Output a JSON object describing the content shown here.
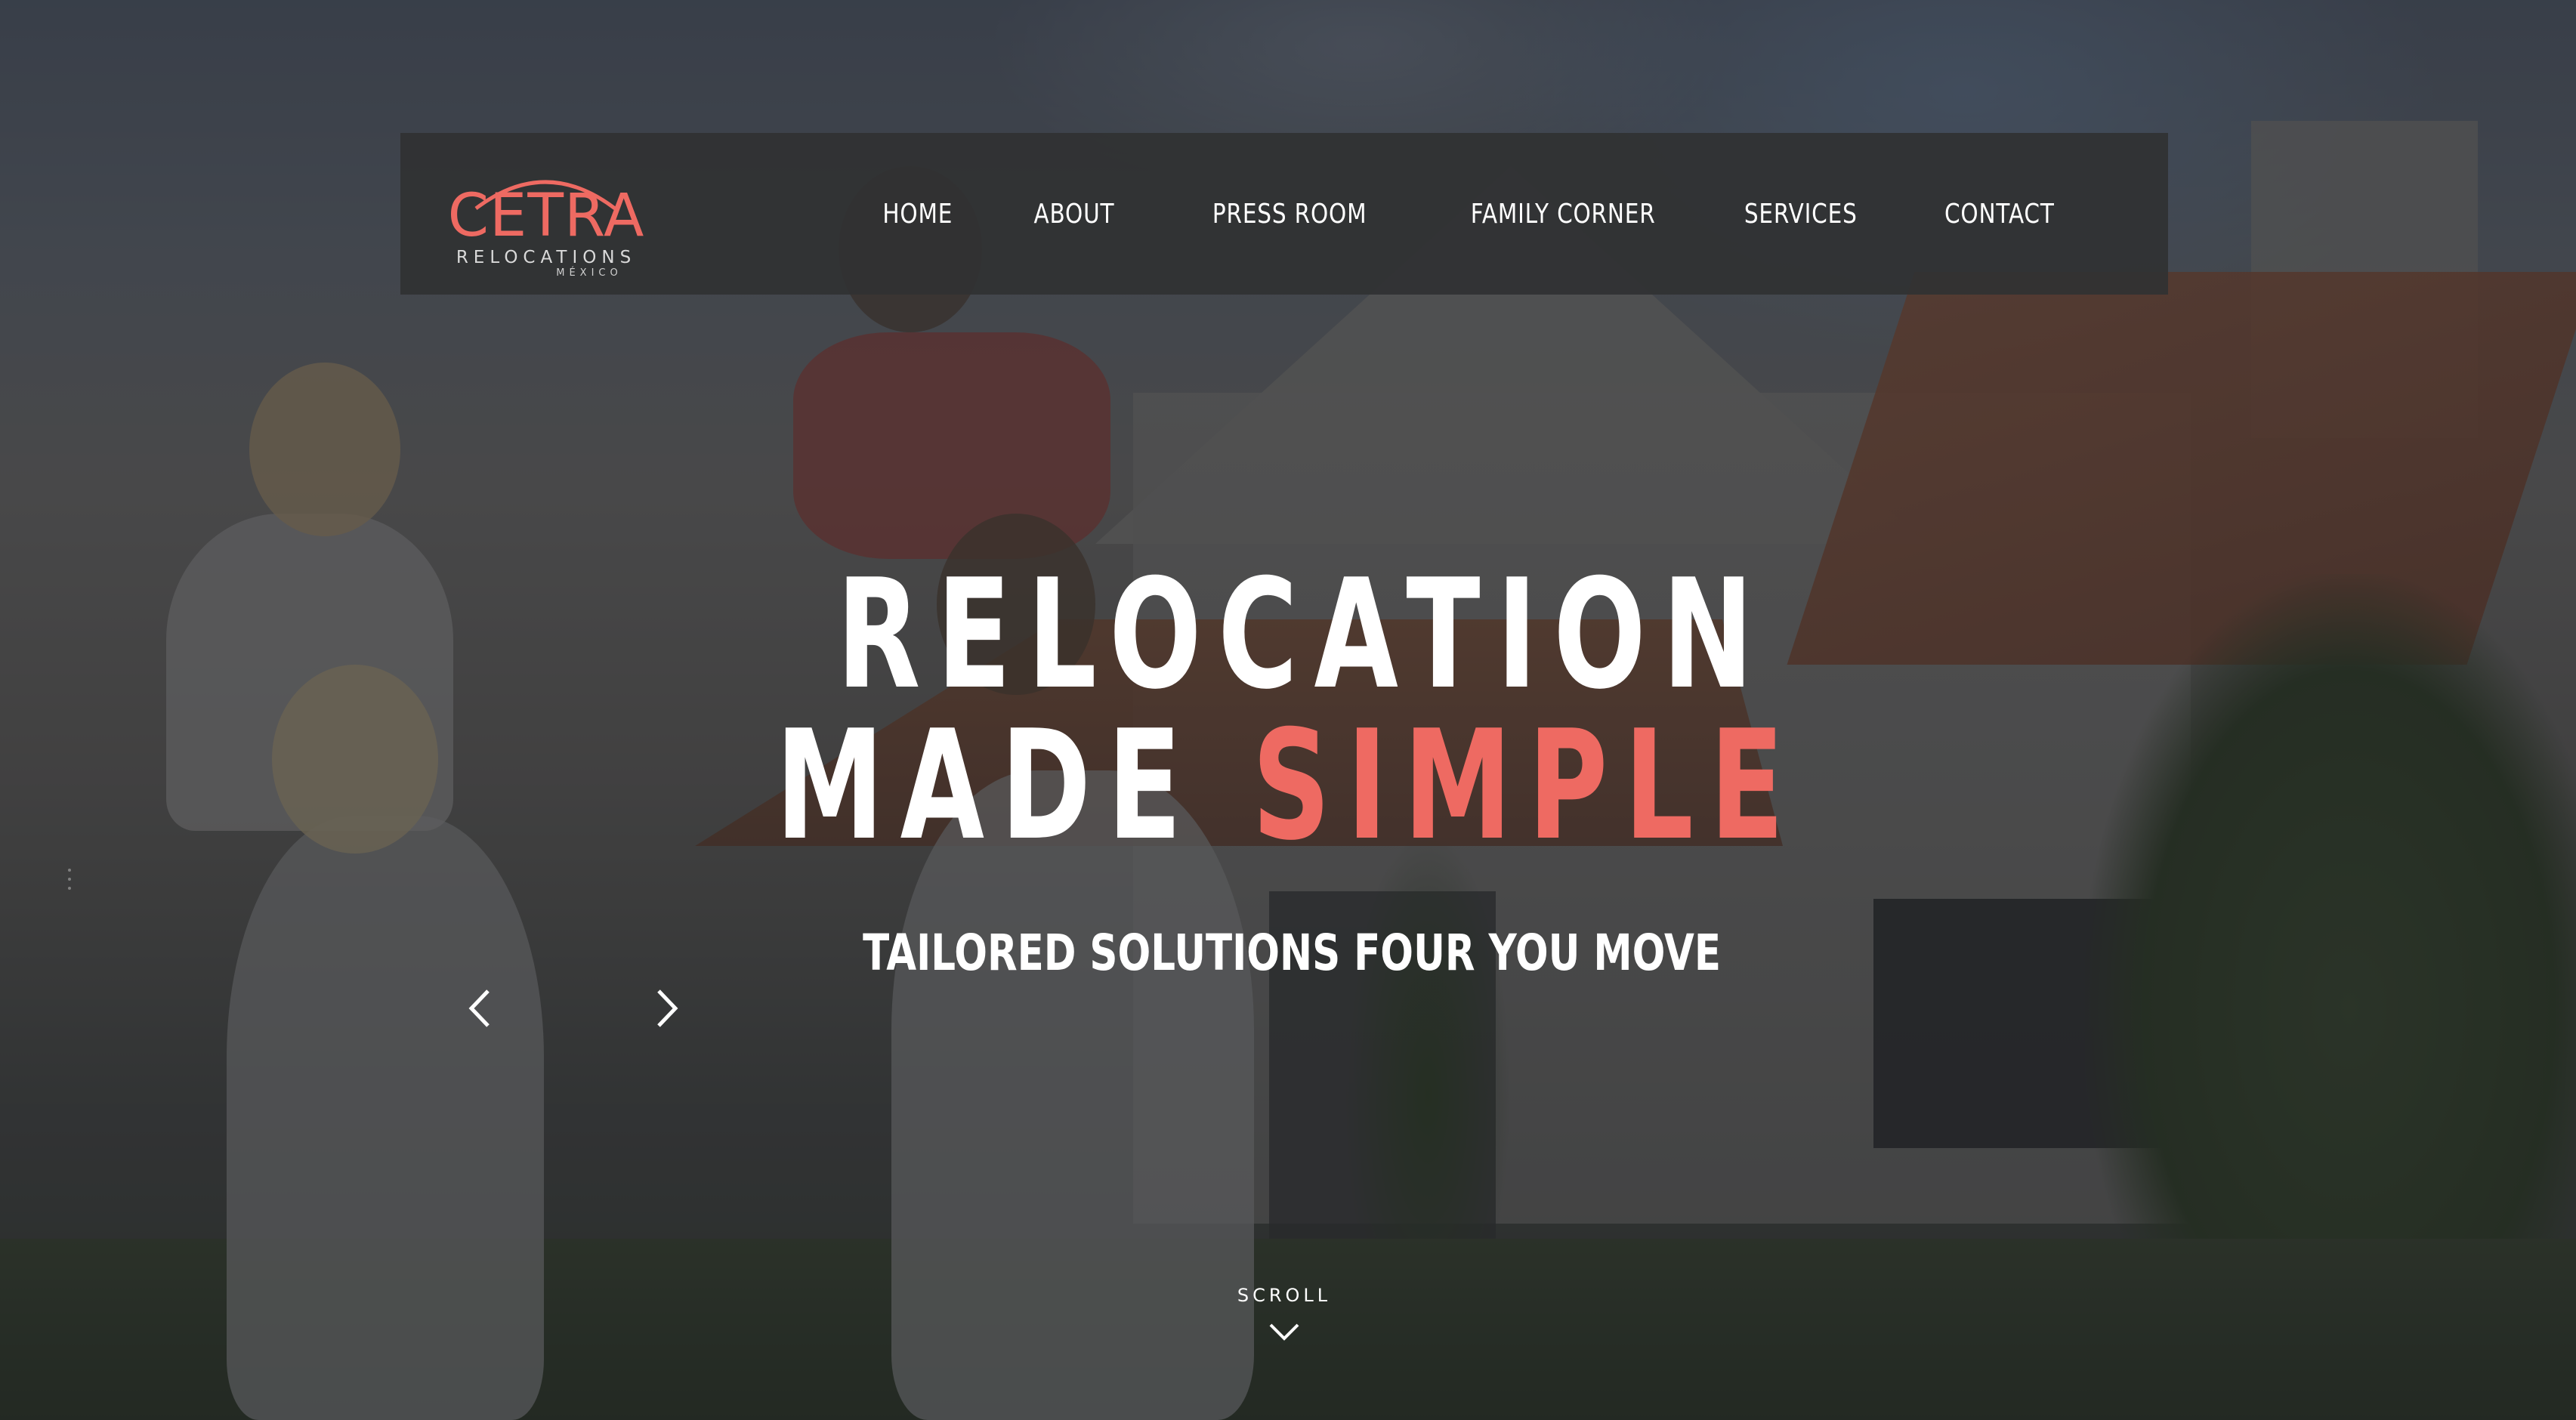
{
  "brand": {
    "name": "CETRA",
    "subtitle": "RELOCATIONS",
    "country": "MÉXICO",
    "accent_color": "#ee6a62"
  },
  "nav": {
    "items": [
      {
        "label": "HOME"
      },
      {
        "label": "ABOUT"
      },
      {
        "label": "PRESS ROOM"
      },
      {
        "label": "FAMILY CORNER"
      },
      {
        "label": "SERVICES"
      },
      {
        "label": "CONTACT"
      }
    ]
  },
  "hero": {
    "headline_line1": "RELOCATION",
    "headline_line2_white": "MADE ",
    "headline_line2_accent": "SIMPLE",
    "subheadline": "TAILORED SOLUTIONS FOUR YOU MOVE",
    "background_image": "family-in-front-of-house-photo"
  },
  "carousel": {
    "prev_icon": "chevron-left-icon",
    "next_icon": "chevron-right-icon"
  },
  "scroll": {
    "label": "SCROLL",
    "icon": "chevron-down-icon"
  }
}
